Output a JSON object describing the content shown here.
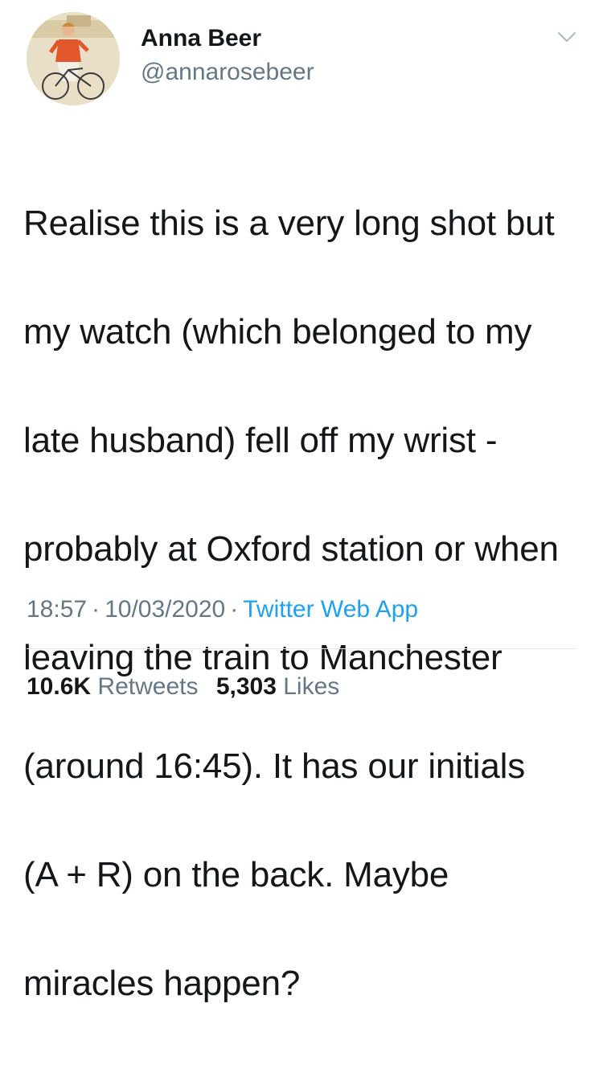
{
  "author": {
    "name": "Anna Beer",
    "handle": "@annarosebeer"
  },
  "tweet": {
    "lines": [
      "Realise this is a very long shot but",
      "my watch (which belonged to my",
      "late husband) fell off my wrist -",
      "probably at Oxford station or when",
      "leaving the train to Manchester",
      "(around 16:45). It has our initials",
      "(A + R) on the back. Maybe",
      "miracles happen?"
    ]
  },
  "meta": {
    "time": "18:57",
    "separator": "·",
    "date": "10/03/2020",
    "source": "Twitter Web App"
  },
  "stats": {
    "retweets_count": "10.6K",
    "retweets_label": "Retweets",
    "likes_count": "5,303",
    "likes_label": "Likes"
  },
  "icons": {
    "menu": "chevron-down-icon"
  },
  "colors": {
    "text": "#14171a",
    "secondary": "#657786",
    "link": "#1da1f2",
    "divider": "#e1e8ed"
  }
}
